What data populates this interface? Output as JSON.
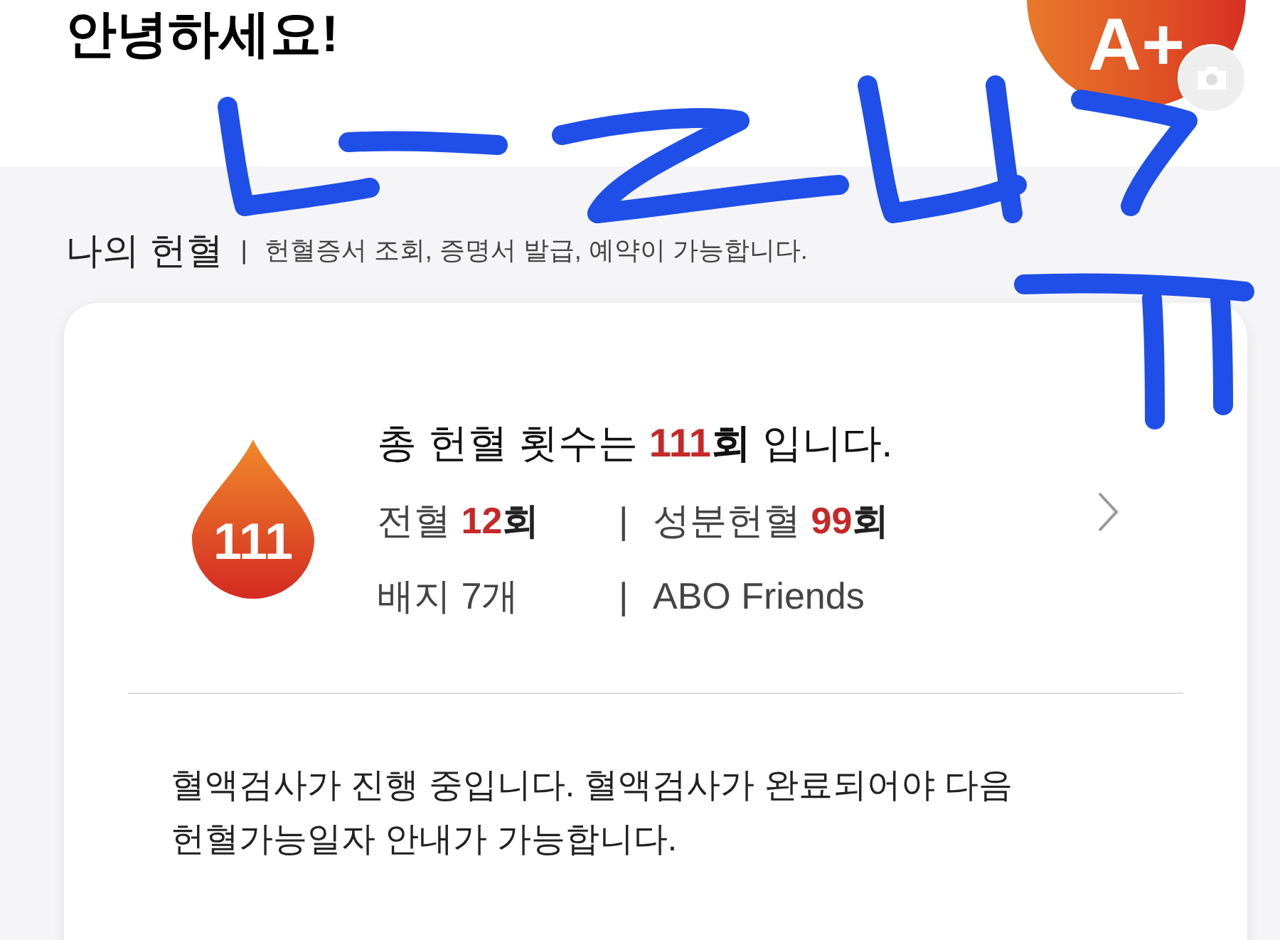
{
  "header": {
    "greeting": "안녕하세요!",
    "avatar": "A+"
  },
  "section": {
    "title": "나의 헌혈",
    "separator": "|",
    "subtitle": "헌혈증서 조회, 증명서 발급, 예약이 가능합니다."
  },
  "card": {
    "badge": "111",
    "summary": {
      "prefix": "총 헌혈 횟수는",
      "count": "111",
      "unit": "회",
      "suffix": "입니다."
    },
    "rows": [
      [
        {
          "label": "전혈",
          "count": "12",
          "unit": "회"
        },
        {
          "label": "성분헌혈",
          "count": "99",
          "unit": "회"
        }
      ],
      [
        {
          "label": "배지 7개"
        },
        {
          "label": "ABO Friends"
        }
      ]
    ],
    "separator": "|",
    "notice": "혈액검사가 진행 중입니다. 혈액검사가 완료되어야 다음 헌혈가능일자 안내가 가능합니다."
  }
}
